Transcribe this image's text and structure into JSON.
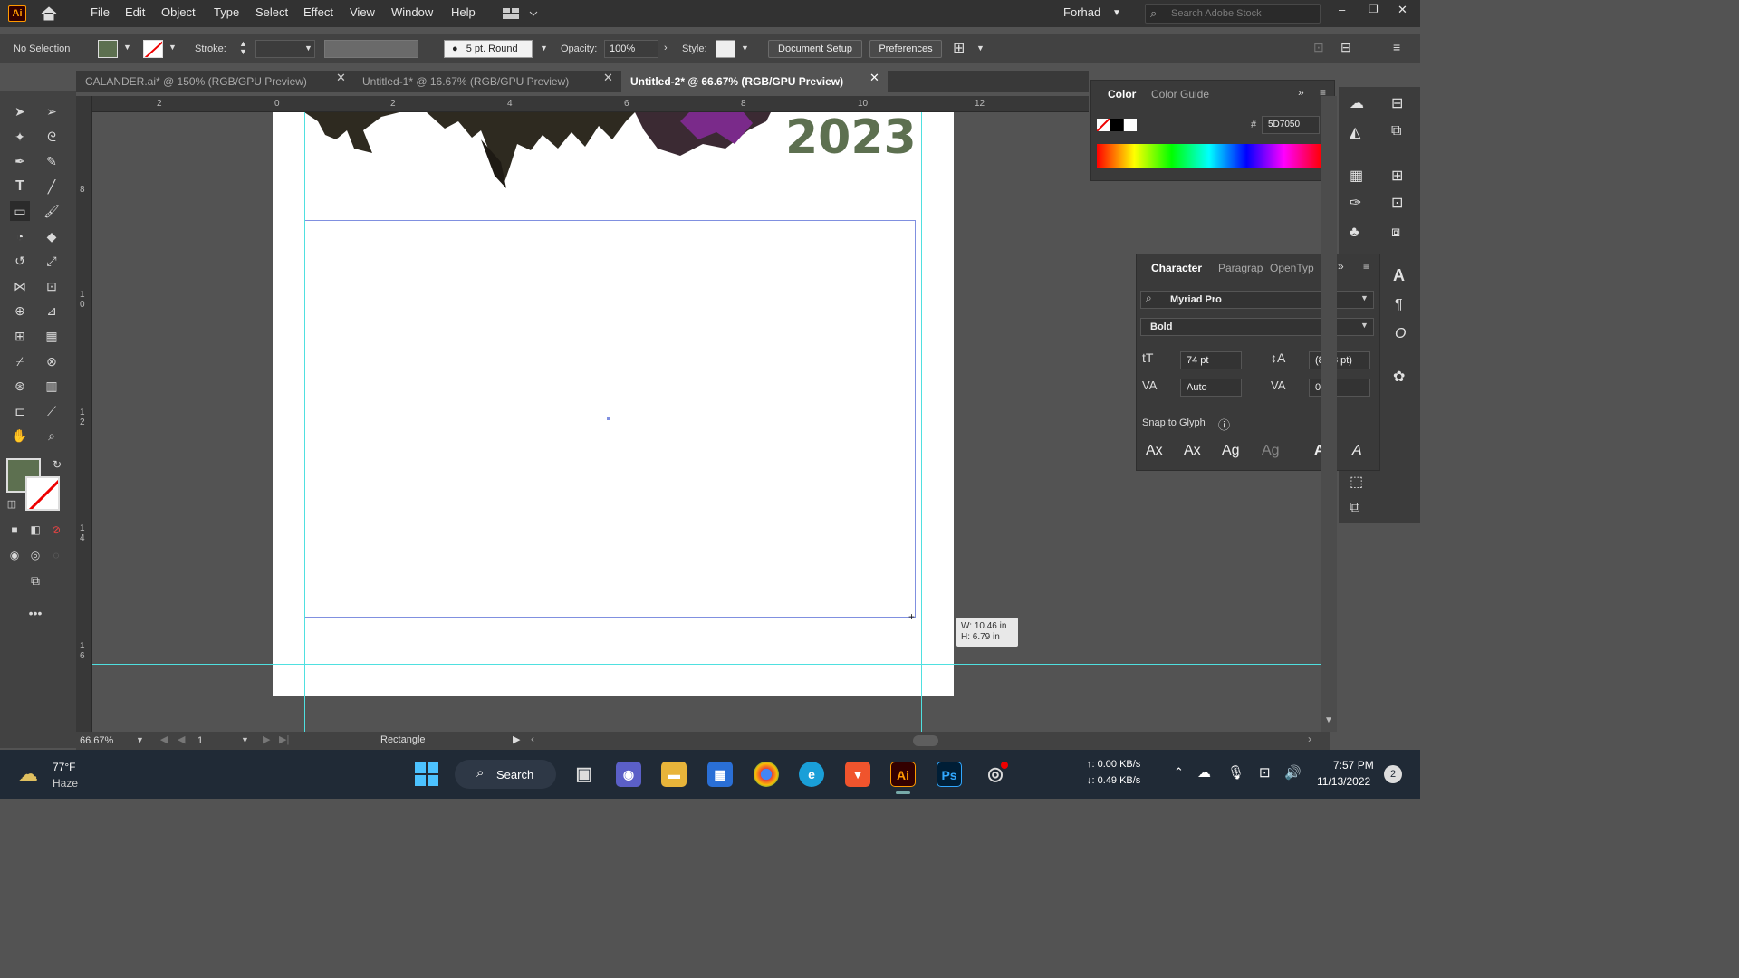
{
  "app": {
    "logo": "Ai"
  },
  "menu": [
    "File",
    "Edit",
    "Object",
    "Type",
    "Select",
    "Effect",
    "View",
    "Window",
    "Help"
  ],
  "account": {
    "user": "Forhad",
    "search_placeholder": "Search Adobe Stock"
  },
  "control": {
    "selection": "No Selection",
    "stroke_label": "Stroke:",
    "brush": "5 pt. Round",
    "opacity_label": "Opacity:",
    "opacity_value": "100%",
    "style_label": "Style:",
    "document_setup": "Document Setup",
    "preferences": "Preferences"
  },
  "tabs": [
    {
      "label": "CALANDER.ai* @ 150% (RGB/GPU Preview)",
      "active": false
    },
    {
      "label": "Untitled-1* @ 16.67% (RGB/GPU Preview)",
      "active": false
    },
    {
      "label": "Untitled-2* @ 66.67% (RGB/GPU Preview)",
      "active": true
    }
  ],
  "ruler": {
    "h": [
      "2",
      "0",
      "2",
      "4",
      "6",
      "8",
      "10",
      "12"
    ],
    "v": [
      "8",
      "1\n0",
      "1\n2",
      "1\n4",
      "1\n6"
    ]
  },
  "artboard": {
    "year": "2023",
    "year_color": "#5d7050",
    "dimension_w": "W: 10.46 in",
    "dimension_h": "H: 6.79 in"
  },
  "color_panel": {
    "tabs": [
      "Color",
      "Color Guide"
    ],
    "hex": "5D7050",
    "fill_color": "#5d7050"
  },
  "character_panel": {
    "tabs": [
      "Character",
      "Paragrap",
      "OpenTyp"
    ],
    "font": "Myriad Pro",
    "style": "Bold",
    "size": "74 pt",
    "leading": "(88.8 pt)",
    "kerning": "Auto",
    "tracking": "0",
    "snap_label": "Snap to Glyph"
  },
  "status": {
    "zoom": "66.67%",
    "page": "1",
    "tool": "Rectangle"
  },
  "taskbar": {
    "temperature": "77°F",
    "weather": "Haze",
    "search": "Search",
    "net_up": "↑: 0.00 KB/s",
    "net_down": "↓: 0.49 KB/s",
    "time": "7:57 PM",
    "date": "11/13/2022",
    "notifications": "2"
  }
}
